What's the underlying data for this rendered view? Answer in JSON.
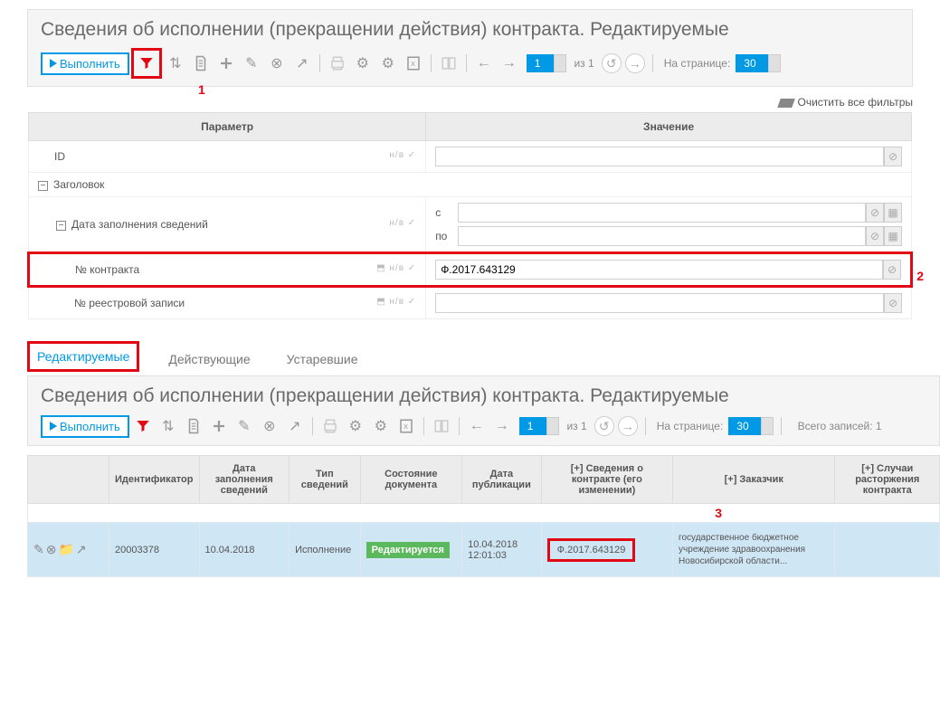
{
  "title": "Сведения об исполнении (прекращении действия) контракта. Редактируемые",
  "run_label": "Выполнить",
  "annot1": "1",
  "annot2": "2",
  "annot3": "3",
  "pager": {
    "current": "1",
    "of_label": "из",
    "total": "1",
    "perpage_label": "На странице:",
    "perpage": "30"
  },
  "clear_filters": "Очистить все фильтры",
  "filter_headers": {
    "param": "Параметр",
    "value": "Значение"
  },
  "filters": {
    "id_label": "ID",
    "header_label": "Заголовок",
    "date_label": "Дата заполнения сведений",
    "date_from": "с",
    "date_to": "по",
    "contract_label": "№ контракта",
    "contract_value": "Ф.2017.643129",
    "registry_label": "№ реестровой записи"
  },
  "tabs": {
    "editable": "Редактируемые",
    "active": "Действующие",
    "obsolete": "Устаревшие"
  },
  "total_records": "Всего записей: 1",
  "columns": {
    "id": "Идентификатор",
    "date_fill": "Дата заполнения сведений",
    "type": "Тип сведений",
    "state": "Состояние документа",
    "pub_date": "Дата публикации",
    "contract_info": "[+] Сведения о контракте (его изменении)",
    "customer": "[+] Заказчик",
    "termination": "[+] Случаи расторжения контракта"
  },
  "row": {
    "id": "20003378",
    "date_fill": "10.04.2018",
    "type": "Исполнение",
    "state": "Редактируется",
    "pub_date": "10.04.2018 12:01:03",
    "contract": "Ф.2017.643129",
    "customer": "государственное бюджетное учреждение здравоохранения Новосибирской области..."
  }
}
